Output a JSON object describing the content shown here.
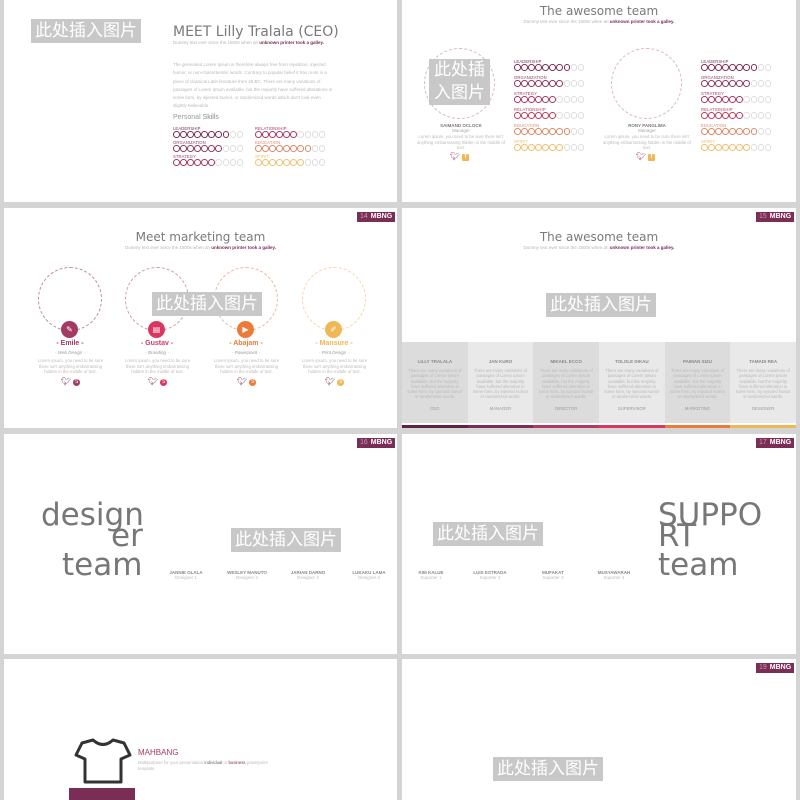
{
  "placeholder_label": "此处插入图片",
  "placeholder_lines": [
    "此处插",
    "入图片"
  ],
  "brand": "MBNG",
  "colors": {
    "plum": "#7a2d55",
    "rose": "#a33a63",
    "crimson": "#d9375f",
    "orange": "#ee7a3a",
    "gold": "#f0b755",
    "text_gray": "#7a7a7a"
  },
  "slide_ceo": {
    "title": "MEET Lilly  Tralala (CEO)",
    "subtitle_plain": "Dummy text ever since the 1500s  when an ",
    "subtitle_bold": "unknown printer took a galley.",
    "body": "The generated Lorem Ipsum is therefore always free from repetition, injected humor, or non-characteristic words. Contrary to popular belief it has roots in a piece of classical Latin literature from 45 BC. There are many variations of passages of Lorem Ipsum available, but the majority have suffered alterations in some form, by injected humor, or randomized words which don't look even slightly believable.",
    "skills_heading_light": "Personal ",
    "skills_heading_bold": "Skills",
    "skills": [
      {
        "label": "LEADERSHIP",
        "level": 8,
        "max": 10,
        "color": "#7a2d55"
      },
      {
        "label": "RELATIONSHIP",
        "level": 6,
        "max": 10,
        "color": "#a33a63"
      },
      {
        "label": "ORGANIZATION",
        "level": 7,
        "max": 10,
        "color": "#8a3a5e"
      },
      {
        "label": "EDUCATION",
        "level": 8,
        "max": 10,
        "color": "#d98a6a"
      },
      {
        "label": "STRATEGY",
        "level": 6,
        "max": 10,
        "color": "#a33a63"
      },
      {
        "label": "SPIRIT",
        "level": 7,
        "max": 10,
        "color": "#f0c070"
      }
    ]
  },
  "slide_awesome_skills": {
    "title": "The awesome team",
    "subtitle_plain": "Dummy text ever since the 1500s  when an ",
    "subtitle_bold": "unknown printer took a galley.",
    "people": [
      {
        "name": "SAIMAND OCLOCK",
        "role": "Manager",
        "desc": "Lorem ipsum, you need to be sure there isn't anything embarrassing hidden in the middle of text.",
        "skills": [
          {
            "label": "LEADERSHIP",
            "level": 8,
            "max": 10,
            "color": "#7a2d55"
          },
          {
            "label": "ORGANIZATION",
            "level": 7,
            "max": 10,
            "color": "#8a3a5e"
          },
          {
            "label": "STRATEGY",
            "level": 6,
            "max": 10,
            "color": "#a33a63"
          },
          {
            "label": "RELATIONSHIP",
            "level": 6,
            "max": 10,
            "color": "#b8405f"
          },
          {
            "label": "EDUCATION",
            "level": 8,
            "max": 10,
            "color": "#d98a6a"
          },
          {
            "label": "SPIRIT",
            "level": 7,
            "max": 10,
            "color": "#f0c070"
          }
        ]
      },
      {
        "name": "RONY PANGLIMA",
        "role": "Manager",
        "desc": "Lorem ipsum, you need to be sure there isn't anything embarrassing hidden in the middle of text.",
        "skills": [
          {
            "label": "LEADERSHIP",
            "level": 8,
            "max": 10,
            "color": "#7a2d55"
          },
          {
            "label": "ORGANIZATION",
            "level": 7,
            "max": 10,
            "color": "#8a3a5e"
          },
          {
            "label": "STRATEGY",
            "level": 6,
            "max": 10,
            "color": "#a33a63"
          },
          {
            "label": "RELATIONSHIP",
            "level": 6,
            "max": 10,
            "color": "#b8405f"
          },
          {
            "label": "EDUCATION",
            "level": 8,
            "max": 10,
            "color": "#d98a6a"
          },
          {
            "label": "SPIRIT",
            "level": 7,
            "max": 10,
            "color": "#f0c070"
          }
        ]
      }
    ]
  },
  "slide_marketing": {
    "page": "14",
    "title": "Meet marketing team",
    "subtitle_plain": "Dummy text ever since the 1500s  when an ",
    "subtitle_bold": "unknown printer took a galley.",
    "members": [
      {
        "name": "- Emile -",
        "role": "- Web Design -",
        "desc": "Lorem ipsum, you need to be sure there isn't anything embarrassing hidden in the middle of text.",
        "color": "#a33a63",
        "icon": "pen-tool-icon",
        "glyph": "✎"
      },
      {
        "name": "- Gustav -",
        "role": "- Branding -",
        "desc": "Lorem ipsum, you need to be sure there isn't anything embarrassing hidden in the middle of text.",
        "color": "#d9375f",
        "icon": "id-card-icon",
        "glyph": "▤"
      },
      {
        "name": "- Abajam -",
        "role": "- Powerpoint -",
        "desc": "Lorem ipsum, you need to be sure there isn't anything embarrassing hidden in the middle of text.",
        "color": "#ee7a3a",
        "icon": "video-camera-icon",
        "glyph": "▶"
      },
      {
        "name": "- Mansure -",
        "role": "- Print Design -",
        "desc": "Lorem ipsum, you need to be sure there isn't anything embarrassing hidden in the middle of text.",
        "color": "#f0b755",
        "icon": "document-icon",
        "glyph": "✐"
      }
    ]
  },
  "slide_awesome_columns": {
    "page": "15",
    "title": "The awesome team",
    "subtitle_plain": "Dummy text ever since the 1500s  when an ",
    "subtitle_bold": "unknown printer took a galley.",
    "columns": [
      {
        "name": "LILLY TRALALA",
        "desc": "There are many variations of passages of Lorem Ipsum available, but the majority have suffered alteration in some form, by injected humor or randomized words.",
        "role": "CEO",
        "stripe": "#5e2245"
      },
      {
        "name": "JAN KURO",
        "desc": "There are many variations of passages of Lorem Ipsum available, but the majority have suffered alteration in some form, by injected humor or randomized words.",
        "role": "MANAGER",
        "stripe": "#7a2d55"
      },
      {
        "name": "MIKAEL ECCO",
        "desc": "There are many variations of passages of Lorem Ipsum available, but the majority have suffered alteration in some form, by injected humor or randomized words.",
        "role": "DIRECTOR",
        "stripe": "#b03a60"
      },
      {
        "name": "TOLOLE DIKAU",
        "desc": "There are many variations of passages of Lorem Ipsum available, but the majority have suffered alteration in some form, by injected humor or randomized words.",
        "role": "SUPERVISOR",
        "stripe": "#d9375f"
      },
      {
        "name": "PAIMAN SIZU",
        "desc": "There are many variations of passages of Lorem Ipsum available, but the majority have suffered alteration in some form, by injected humor or randomized words.",
        "role": "MARKETING",
        "stripe": "#ee7a3a"
      },
      {
        "name": "TAMADI REA",
        "desc": "There are many variations of passages of Lorem Ipsum available, but the majority have suffered alteration in some form, by injected humor or randomized words.",
        "role": "DESIGNER",
        "stripe": "#f0b755"
      }
    ]
  },
  "slide_designer": {
    "page": "16",
    "word_line1": "design",
    "word_line2": "er",
    "word_line3": "team",
    "members": [
      {
        "name": "JANNIE OLALA",
        "role": "Designer 1"
      },
      {
        "name": "WESLEY MANUTO",
        "role": "Designer 2"
      },
      {
        "name": "JARIAN DARNO",
        "role": "Designer 3"
      },
      {
        "name": "LUKAKU LAMA",
        "role": "Designer 4"
      }
    ]
  },
  "slide_support": {
    "page": "17",
    "word_line1": "SUPPO",
    "word_line2": "RT",
    "word_line3": "team",
    "members": [
      {
        "name": "KIM KALUE",
        "role": "Suporter 1"
      },
      {
        "name": "LUIS ESTRADA",
        "role": "Suporter 2"
      },
      {
        "name": "MUFAKAT",
        "role": "Suporter 3"
      },
      {
        "name": "MUSYAWARAH",
        "role": "Suporter 4"
      }
    ]
  },
  "slide_mahbang": {
    "title": "MAHBANG",
    "desc_plain1": "Multipurpose for your presentation ",
    "desc_bold1": "individual",
    "desc_plain2": " or ",
    "desc_bold2": "business",
    "desc_plain3": " powerpoint template"
  },
  "slide_last": {
    "page": "19"
  }
}
